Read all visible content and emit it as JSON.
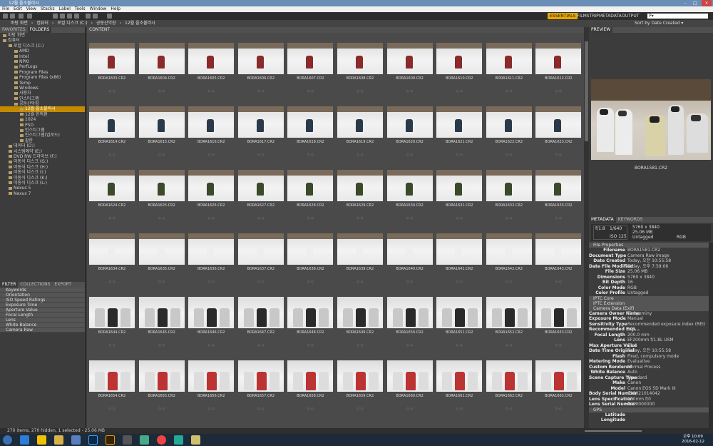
{
  "window": {
    "title": "12월 을소불러시"
  },
  "menu": [
    "File",
    "Edit",
    "View",
    "Stacks",
    "Label",
    "Tools",
    "Window",
    "Help"
  ],
  "workspaces": [
    {
      "label": "ESSENTIALS",
      "active": true
    },
    {
      "label": "FILMSTRIP",
      "active": false
    },
    {
      "label": "METADATA",
      "active": false
    },
    {
      "label": "OUTPUT",
      "active": false
    }
  ],
  "search": {
    "placeholder": "P▾"
  },
  "sort": "Sort by Date Created ▾",
  "path": [
    "바탕 화면",
    "컴퓨터",
    "로컬 디스크 (C:)",
    "공동산악장",
    "12월 을소불러시"
  ],
  "left": {
    "tabs": [
      "FAVORITES",
      "FOLDERS"
    ],
    "tree": [
      {
        "label": "바탕 화면",
        "indent": 0,
        "sel": false
      },
      {
        "label": "컴퓨터",
        "indent": 0,
        "sel": false
      },
      {
        "label": "로컬 디스크 (C:)",
        "indent": 1,
        "sel": false
      },
      {
        "label": "AMD",
        "indent": 2,
        "sel": false
      },
      {
        "label": "Intel",
        "indent": 2,
        "sel": false
      },
      {
        "label": "NPKI",
        "indent": 2,
        "sel": false
      },
      {
        "label": "PerfLogs",
        "indent": 2,
        "sel": false
      },
      {
        "label": "Program Files",
        "indent": 2,
        "sel": false
      },
      {
        "label": "Program Files (x86)",
        "indent": 2,
        "sel": false
      },
      {
        "label": "Temp",
        "indent": 2,
        "sel": false
      },
      {
        "label": "Windows",
        "indent": 2,
        "sel": false
      },
      {
        "label": "사용자",
        "indent": 2,
        "sel": false
      },
      {
        "label": "인스타그램",
        "indent": 2,
        "sel": false
      },
      {
        "label": "공동산악장",
        "indent": 2,
        "sel": false
      },
      {
        "label": "12월 을소불러시",
        "indent": 3,
        "sel": true
      },
      {
        "label": "12월 한독환",
        "indent": 3,
        "sel": false
      },
      {
        "label": "1024",
        "indent": 3,
        "sel": false
      },
      {
        "label": "PSD",
        "indent": 3,
        "sel": false
      },
      {
        "label": "인스타그램",
        "indent": 3,
        "sel": false
      },
      {
        "label": "인스타그램(업로드)",
        "indent": 3,
        "sel": false
      },
      {
        "label": "팔한",
        "indent": 3,
        "sel": false
      },
      {
        "label": "데이터 (D:)",
        "indent": 1,
        "sel": false
      },
      {
        "label": "시스템예약 (E:)",
        "indent": 1,
        "sel": false
      },
      {
        "label": "DVD RW 드라이브 (F:)",
        "indent": 1,
        "sel": false
      },
      {
        "label": "이동식 디스크 (G:)",
        "indent": 1,
        "sel": false
      },
      {
        "label": "이동식 디스크 (H:)",
        "indent": 1,
        "sel": false
      },
      {
        "label": "이동식 디스크 (I:)",
        "indent": 1,
        "sel": false
      },
      {
        "label": "이동식 디스크 (K:)",
        "indent": 1,
        "sel": false
      },
      {
        "label": "이동식 디스크 (L:)",
        "indent": 1,
        "sel": false
      },
      {
        "label": "Nexus 5",
        "indent": 1,
        "sel": false
      },
      {
        "label": "Nexus 7",
        "indent": 1,
        "sel": false
      }
    ],
    "filter_tabs": [
      "FILTER",
      "COLLECTIONS",
      "EXPORT"
    ],
    "filters": [
      "Keywords",
      "Orientation",
      "ISO Speed Ratings",
      "Exposure Time",
      "Aperture Value",
      "Focal Length",
      "Lens",
      "White Balance",
      "Camera Raw"
    ]
  },
  "content": {
    "tab": "CONTENT",
    "files": [
      "BORA1603.CR2",
      "BORA1604.CR2",
      "BORA1605.CR2",
      "BORA1606.CR2",
      "BORA1607.CR2",
      "BORA1608.CR2",
      "BORA1609.CR2",
      "BORA1610.CR2",
      "BORA1611.CR2",
      "BORA1612.CR2",
      "BORA1614.CR2",
      "BORA1615.CR2",
      "BORA1616.CR2",
      "BORA1617.CR2",
      "BORA1618.CR2",
      "BORA1619.CR2",
      "BORA1620.CR2",
      "BORA1621.CR2",
      "BORA1622.CR2",
      "BORA1623.CR2",
      "BORA1624.CR2",
      "BORA1625.CR2",
      "BORA1626.CR2",
      "BORA1627.CR2",
      "BORA1628.CR2",
      "BORA1629.CR2",
      "BORA1630.CR2",
      "BORA1631.CR2",
      "BORA1632.CR2",
      "BORA1633.CR2",
      "BORA1634.CR2",
      "BORA1635.CR2",
      "BORA1636.CR2",
      "BORA1637.CR2",
      "BORA1638.CR2",
      "BORA1639.CR2",
      "BORA1640.CR2",
      "BORA1641.CR2",
      "BORA1642.CR2",
      "BORA1643.CR2",
      "BORA1644.CR2",
      "BORA1645.CR2",
      "BORA1646.CR2",
      "BORA1647.CR2",
      "BORA1648.CR2",
      "BORA1649.CR2",
      "BORA1650.CR2",
      "BORA1651.CR2",
      "BORA1652.CR2",
      "BORA1653.CR2",
      "BORA1654.CR2",
      "BORA1655.CR2",
      "BORA1656.CR2",
      "BORA1657.CR2",
      "BORA1658.CR2",
      "BORA1659.CR2",
      "BORA1660.CR2",
      "BORA1661.CR2",
      "BORA1662.CR2",
      "BORA1663.CR2"
    ]
  },
  "right": {
    "preview_tab": "PREVIEW",
    "preview_name": "BORA1581.CR2",
    "meta_tabs": [
      "METADATA",
      "KEYWORDS"
    ],
    "exposure": {
      "aperture": "f/1.8",
      "shutter": "1/640",
      "iso": "ISO 125",
      "dims": "5760 x 3840",
      "size": "25.06 MB",
      "label": "Untagged",
      "color": "RGB"
    },
    "file_props_title": "File Properties",
    "file_props": [
      [
        "Filename",
        "BORA1581.CR2"
      ],
      [
        "Document Type",
        "Camera Raw image"
      ],
      [
        "Date Created",
        "Today, 오전 10:55:58"
      ],
      [
        "Date File Modified",
        "Today, 오후 7:59:06"
      ],
      [
        "File Size",
        "25.06 MB"
      ],
      [
        "Dimensions",
        "5760 x 3840"
      ],
      [
        "Bit Depth",
        "16"
      ],
      [
        "Color Mode",
        "RGB"
      ],
      [
        "Color Profile",
        "Untagged"
      ]
    ],
    "iptc_core": "IPTC Core",
    "iptc_ext": "IPTC Extension",
    "camera_title": "Camera Data (Exif)",
    "camera": [
      [
        "Camera Owner Name",
        "Tinkyominy"
      ],
      [
        "Exposure Mode",
        "Manual"
      ],
      [
        "Sensitivity Type",
        "Recommended exposure index (REI)"
      ],
      [
        "Recommended Exp...",
        "125"
      ],
      [
        "Focal Length",
        "200.0 mm"
      ],
      [
        "Lens",
        "EF200mm f/1.8L USM"
      ],
      [
        "Max Aperture Value",
        "f/1.8"
      ],
      [
        "Date Time Original",
        "Today, 오전 10:55:58"
      ],
      [
        "Flash",
        "Fired, compulsory mode"
      ],
      [
        "Metering Mode",
        "Evaluative"
      ],
      [
        "Custom Rendered",
        "Normal Process"
      ],
      [
        "White Balance",
        "Auto"
      ],
      [
        "Scene Capture Type",
        "Standard"
      ],
      [
        "Make",
        "Canon"
      ],
      [
        "Model",
        "Canon EOS 5D Mark III"
      ],
      [
        "Body Serial Number",
        "028021014042"
      ],
      [
        "Lens Specification",
        "200mm f/0"
      ],
      [
        "Lens Serial Number",
        "0000000000"
      ]
    ],
    "gps_title": "GPS",
    "gps": [
      "Latitude",
      "Longitude"
    ]
  },
  "status": "270 items, 270 hidden, 1 selected - 25.06 MB",
  "clock": {
    "time": "오후 10:09",
    "date": "2016-02-12"
  }
}
